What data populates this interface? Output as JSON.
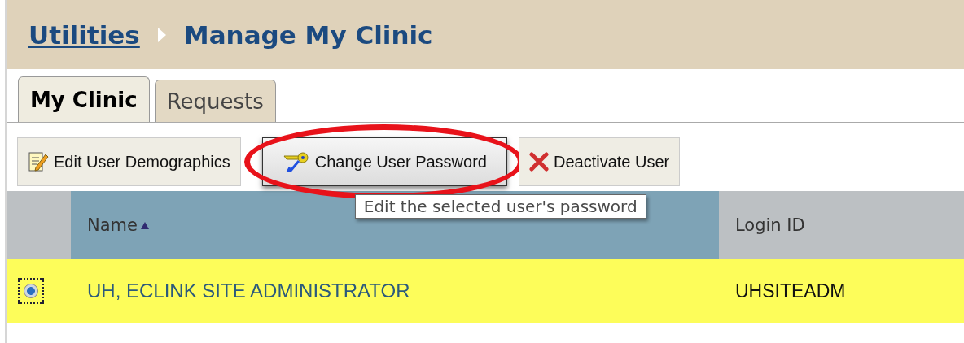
{
  "breadcrumb": {
    "link": "Utilities",
    "current": "Manage My Clinic"
  },
  "tabs": [
    {
      "label": "My Clinic",
      "selected": true
    },
    {
      "label": "Requests",
      "selected": false
    }
  ],
  "toolbar": {
    "buttons": [
      {
        "label": "Edit User Demographics",
        "kind": "edit",
        "hovered": false,
        "circled": false
      },
      {
        "label": "Change User Password",
        "kind": "key",
        "hovered": true,
        "circled": true
      },
      {
        "label": "Deactivate User",
        "kind": "delete",
        "hovered": false,
        "circled": false
      }
    ]
  },
  "tooltip": "Edit the selected user's password",
  "table": {
    "columns": [
      {
        "label": "Name",
        "sorted": true
      },
      {
        "label": "Login ID",
        "sorted": false
      }
    ],
    "rows": [
      {
        "name": "UH, ECLINK SITE ADMINISTRATOR",
        "login_id": "UHSITEADM",
        "selected": true
      }
    ]
  }
}
